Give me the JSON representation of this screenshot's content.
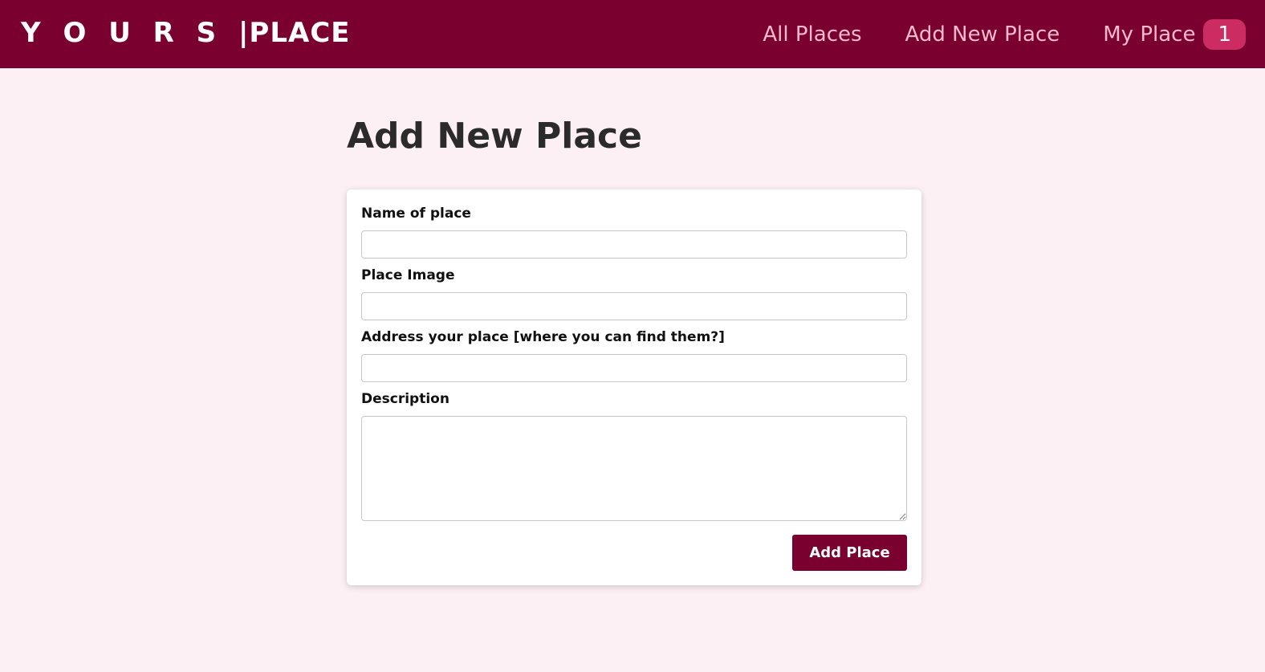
{
  "header": {
    "logo_left": "Y O U R S",
    "logo_right": "|PLACE",
    "nav": {
      "all_places": "All Places",
      "add_new_place": "Add New Place",
      "my_place": "My Place",
      "my_place_count": "1"
    }
  },
  "main": {
    "title": "Add New Place",
    "form": {
      "name_label": "Name of place",
      "name_value": "",
      "image_label": "Place Image",
      "image_value": "",
      "address_label": "Address your place [where you can find them?]",
      "address_value": "",
      "description_label": "Description",
      "description_value": "",
      "submit_label": "Add Place"
    }
  },
  "colors": {
    "brand": "#7a0030",
    "page_background": "#fcf0f4",
    "nav_text": "#f7b9cc",
    "badge": "#cc2c62"
  }
}
